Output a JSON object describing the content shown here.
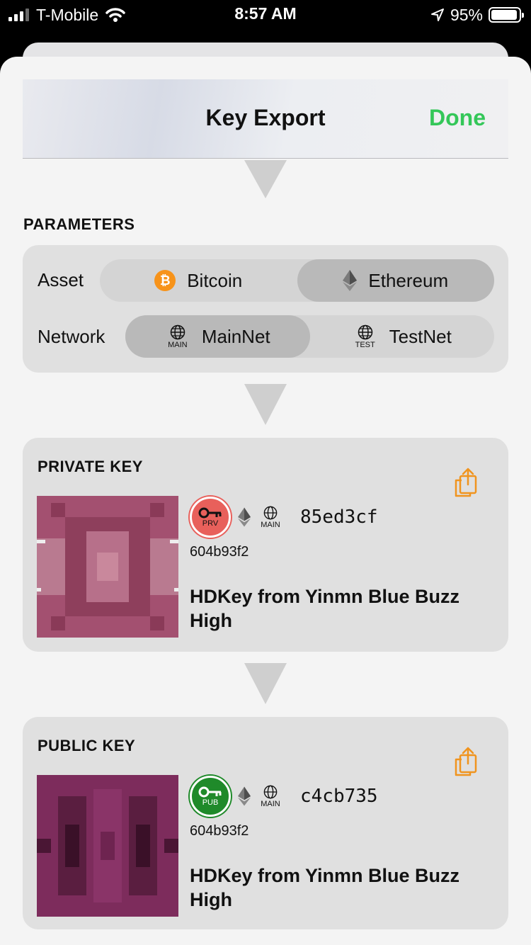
{
  "status_bar": {
    "carrier": "T-Mobile",
    "time": "8:57 AM",
    "battery": "95%",
    "battery_level": 0.95
  },
  "nav": {
    "title": "Key Export",
    "done": "Done"
  },
  "parameters": {
    "section_label": "PARAMETERS",
    "asset_label": "Asset",
    "assets": [
      {
        "label": "Bitcoin",
        "icon": "bitcoin-icon",
        "selected": false
      },
      {
        "label": "Ethereum",
        "icon": "ethereum-icon",
        "selected": true
      }
    ],
    "network_label": "Network",
    "networks": [
      {
        "label": "MainNet",
        "caption": "MAIN",
        "icon": "globe-icon",
        "selected": true
      },
      {
        "label": "TestNet",
        "caption": "TEST",
        "icon": "globe-icon",
        "selected": false
      }
    ]
  },
  "private_key": {
    "section_label": "PRIVATE KEY",
    "badge": "PRV",
    "badge_color": "#e8605b",
    "network_caption": "MAIN",
    "fingerprint": "85ed3cf",
    "id": "604b93f2",
    "name": "HDKey from Yinmn Blue Buzz High"
  },
  "public_key": {
    "section_label": "PUBLIC KEY",
    "badge": "PUB",
    "badge_color": "#1f8a2a",
    "network_caption": "MAIN",
    "fingerprint": "c4cb735",
    "id": "604b93f2",
    "name": "HDKey from Yinmn Blue Buzz High"
  },
  "colors": {
    "accent_done": "#34c759",
    "share_icon": "#f0941e"
  }
}
